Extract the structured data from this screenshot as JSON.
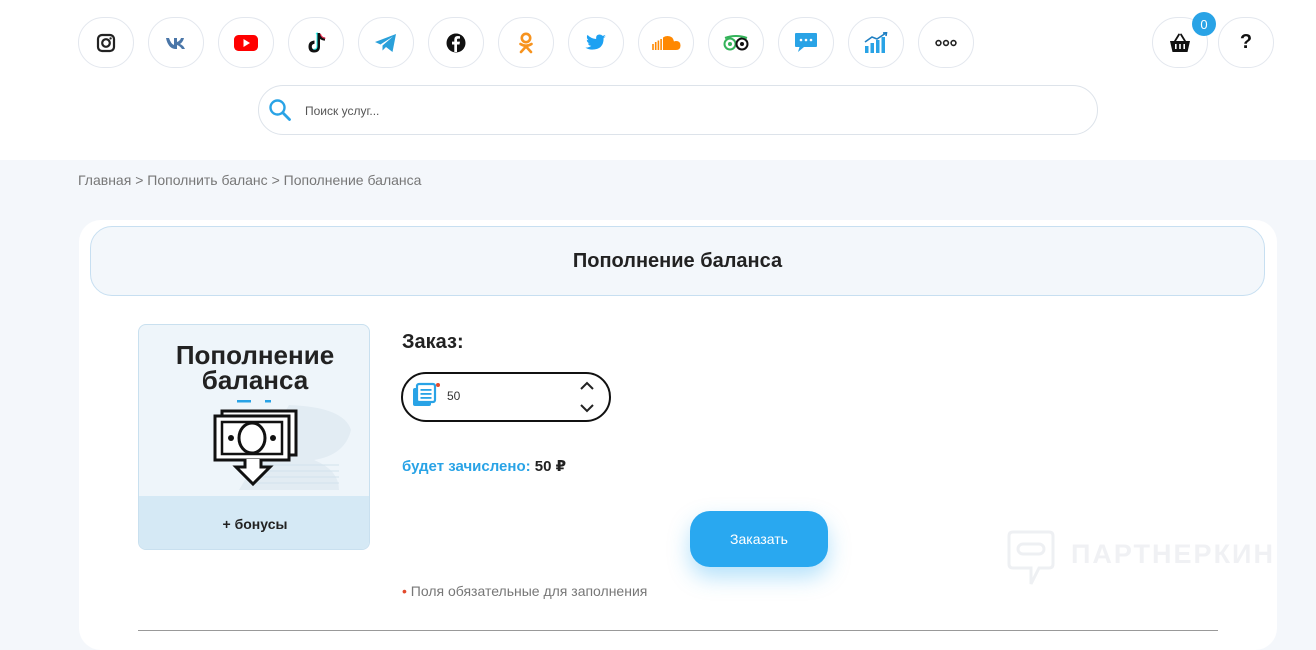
{
  "social_icons": [
    {
      "name": "instagram-icon",
      "color": "#222222"
    },
    {
      "name": "vk-icon",
      "color": "#4a76a8"
    },
    {
      "name": "youtube-icon",
      "color": "#ff0000"
    },
    {
      "name": "tiktok-icon",
      "color": "#111111"
    },
    {
      "name": "telegram-icon",
      "color": "#2aa0da"
    },
    {
      "name": "facebook-icon",
      "color": "#111111"
    },
    {
      "name": "odnoklassniki-icon",
      "color": "#f7931e"
    },
    {
      "name": "twitter-icon",
      "color": "#1da1f2"
    },
    {
      "name": "soundcloud-icon",
      "color": "#ff8800"
    },
    {
      "name": "tripadvisor-icon",
      "color": "#34b35a"
    },
    {
      "name": "message-icon",
      "color": "#29a3e6"
    },
    {
      "name": "stats-icon",
      "color": "#29a3e6"
    },
    {
      "name": "more-icon",
      "color": "#222222"
    }
  ],
  "cart": {
    "count": "0"
  },
  "help": {
    "label": "?"
  },
  "search": {
    "placeholder": "Поиск услуг..."
  },
  "breadcrumb": {
    "home": "Главная",
    "separator": ">",
    "parent": "Пополнить баланс",
    "current": "Пополнение баланса"
  },
  "page": {
    "title": "Пополнение баланса"
  },
  "promo": {
    "title_line1": "Пополнение",
    "title_line2": "баланса",
    "footer": "+ бонусы"
  },
  "order": {
    "label": "Заказ:",
    "quantity": "50",
    "credited_label": "будет зачислено:",
    "credited_value": "50 ₽",
    "submit_label": "Заказать",
    "required_marker": "•",
    "required_note": "Поля обязательные для заполнения"
  },
  "watermark": {
    "text": "ПАРТНЕРКИН"
  },
  "colors": {
    "accent": "#29a3e6",
    "required": "#e24a2d"
  }
}
